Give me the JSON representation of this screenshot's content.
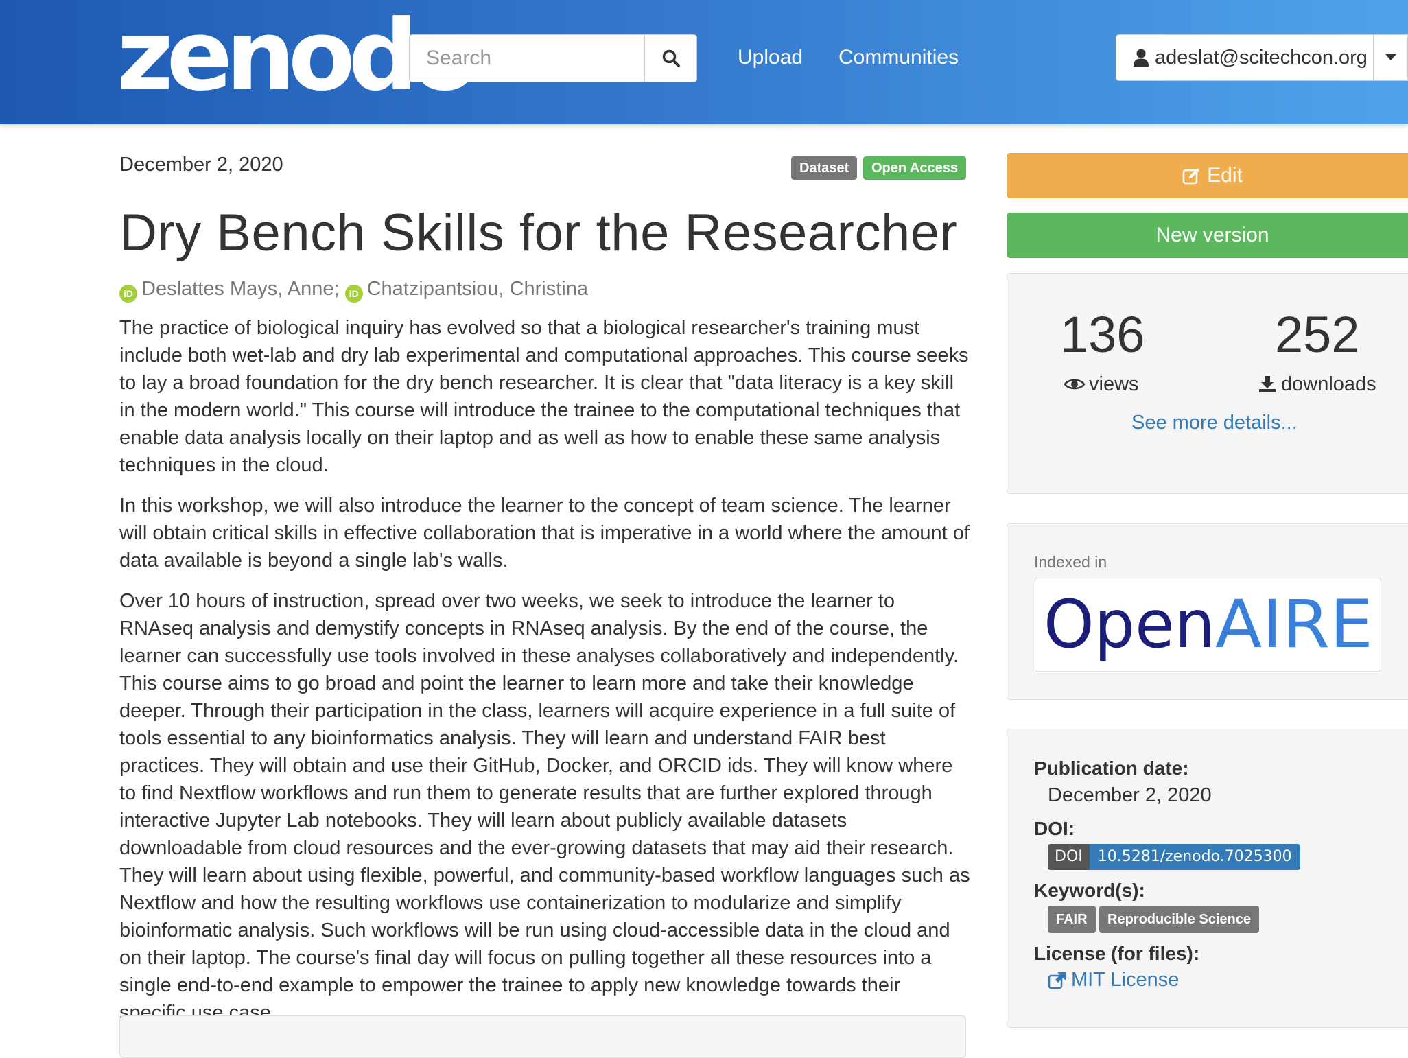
{
  "header": {
    "logo_text": "zenodo",
    "search_placeholder": "Search",
    "nav": {
      "upload": "Upload",
      "communities": "Communities"
    },
    "user_email": "adeslat@scitechcon.org"
  },
  "record": {
    "date": "December 2, 2020",
    "badges": {
      "type": "Dataset",
      "access": "Open Access"
    },
    "title": "Dry Bench Skills for the Researcher",
    "creators": [
      {
        "name": "Deslattes Mays, Anne",
        "separator": ";"
      },
      {
        "name": "Chatzipantsiou, Christina",
        "separator": ""
      }
    ],
    "orcid_icon_text": "iD",
    "description": [
      "The practice of biological inquiry has evolved so that a biological researcher's training must include both wet-lab and dry lab experimental and computational approaches. This course seeks to lay a broad foundation for the dry bench researcher. It is clear that \"data literacy is a key skill in the modern world.\" This course will introduce the trainee to the computational techniques that enable data analysis locally on their laptop and as well as how to enable these same analysis techniques in the cloud.",
      "In this workshop, we will also introduce the learner to the concept of team science. The learner will obtain critical skills in effective collaboration that is imperative in a world where the amount of data available is beyond a single lab's walls.",
      "Over 10 hours of instruction, spread over two weeks, we seek to introduce the learner to RNAseq analysis and demystify concepts in RNAseq analysis. By the end of the course, the learner can successfully use tools involved in these analyses collaboratively and independently. This course aims to go broad and point the learner to learn more and take their knowledge deeper. Through their participation in the class, learners will acquire experience in a full suite of tools essential to any bioinformatics analysis. They will learn and understand FAIR best practices. They will obtain and use their GitHub, Docker, and ORCID ids. They will know where to find Nextflow workflows and run them to generate results that are further explored through interactive Jupyter Lab notebooks. They will learn about publicly available datasets downloadable from cloud resources and the ever-growing datasets that may aid their research. They will learn about using flexible, powerful, and community-based workflow languages such as Nextflow and how the resulting  workflows use containerization to modularize and simplify bioinformatic analysis. Such workflows will be run using cloud-accessible data in the cloud and on their laptop. The course's final day will focus on pulling together all these resources into a single end-to-end example to empower the trainee to apply new knowledge towards their specific use case."
    ]
  },
  "sidebar": {
    "edit_label": "Edit",
    "new_version_label": "New version",
    "stats": {
      "views": "136",
      "views_label": "views",
      "downloads": "252",
      "downloads_label": "downloads"
    },
    "see_more": "See more details...",
    "indexed_in": "Indexed in",
    "openaire": {
      "part1": "Open",
      "part2": "AIRE"
    },
    "meta": {
      "pub_date_label": "Publication date:",
      "pub_date": "December 2, 2020",
      "doi_label": "DOI:",
      "doi_prefix": "DOI",
      "doi": "10.5281/zenodo.7025300",
      "keywords_label": "Keyword(s):",
      "keywords": [
        "FAIR",
        "Reproducible Science"
      ],
      "license_label": "License (for files):",
      "license": "MIT License"
    }
  },
  "colors": {
    "header_start": "#1e59b3",
    "header_end": "#4fa3ea",
    "edit": "#f0ad4e",
    "new_version": "#5cb85c",
    "dataset_badge": "#777777",
    "open_access_badge": "#5cb85c",
    "link": "#337ab7",
    "doi_value": "#337ab7",
    "openaire_dark": "#1c1f7a",
    "openaire_light": "#3a7fd9"
  }
}
